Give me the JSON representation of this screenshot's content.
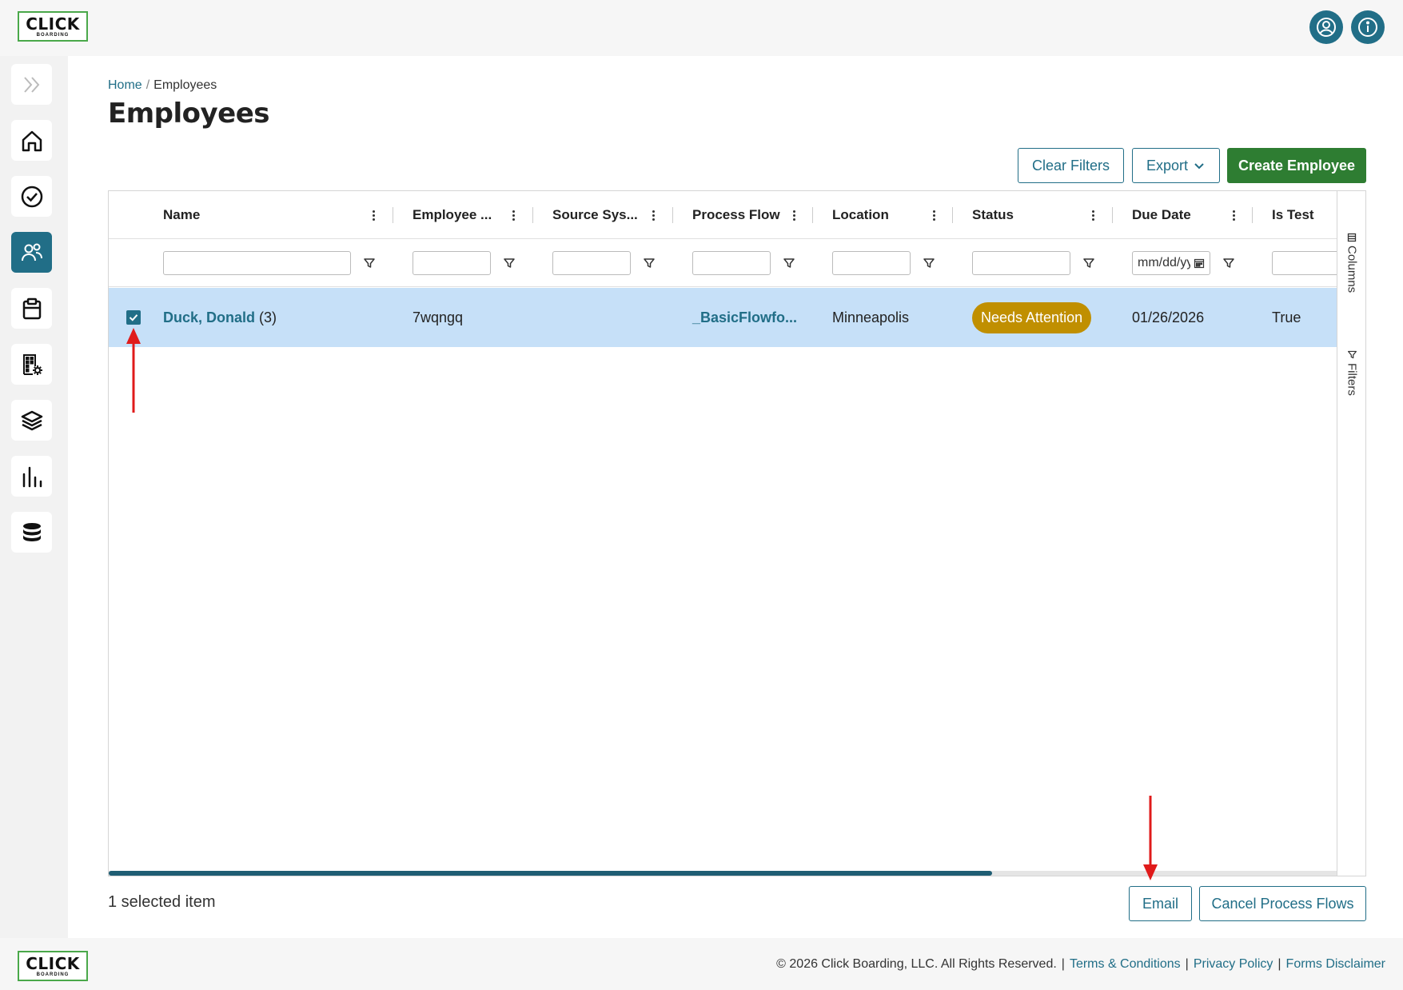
{
  "brand": {
    "logo_line1": "CLICK",
    "logo_line2": "BOARDING",
    "primary_color": "#216e87",
    "green_color": "#2e7d32"
  },
  "header": {
    "icons": [
      "user-profile-icon",
      "info-icon"
    ]
  },
  "sidebar": {
    "items": [
      {
        "icon": "expand-chevrons-icon"
      },
      {
        "icon": "home-icon"
      },
      {
        "icon": "check-circle-icon"
      },
      {
        "icon": "users-icon",
        "active": true
      },
      {
        "icon": "clipboard-icon"
      },
      {
        "icon": "building-settings-icon"
      },
      {
        "icon": "layers-icon"
      },
      {
        "icon": "bar-chart-icon"
      },
      {
        "icon": "database-icon"
      }
    ]
  },
  "breadcrumb": {
    "home": "Home",
    "separator": "/",
    "current": "Employees"
  },
  "page": {
    "title": "Employees"
  },
  "toolbar": {
    "clear_filters": "Clear Filters",
    "export": "Export",
    "create_employee": "Create Employee"
  },
  "grid": {
    "columns": [
      "Name",
      "Employee ...",
      "Source Sys...",
      "Process Flow",
      "Location",
      "Status",
      "Due Date",
      "Is Test"
    ],
    "date_placeholder": "mm/dd/yyyy",
    "rows": [
      {
        "selected": true,
        "name": "Duck, Donald",
        "name_count": "(3)",
        "employee_id": "7wqngq",
        "source_system": "",
        "process_flow": "_BasicFlowfo...",
        "location": "Minneapolis",
        "status": "Needs Attention",
        "status_color": "#c08f00",
        "due_date": "01/26/2026",
        "is_test": "True"
      }
    ],
    "side_tabs": {
      "columns": "Columns",
      "filters": "Filters"
    }
  },
  "selection": {
    "text": "1 selected item",
    "email": "Email",
    "cancel_process_flows": "Cancel Process Flows"
  },
  "footer": {
    "copyright": "© 2026 Click Boarding, LLC. All Rights Reserved.",
    "terms": "Terms & Conditions",
    "privacy": "Privacy Policy",
    "forms_disclaimer": "Forms Disclaimer"
  }
}
